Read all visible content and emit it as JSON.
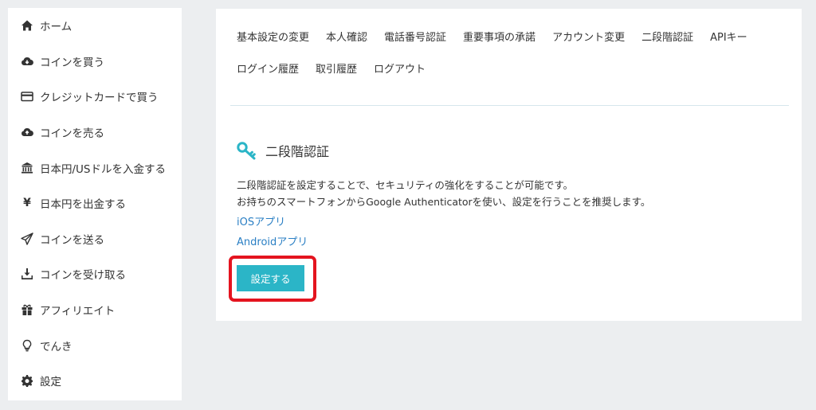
{
  "sidebar": {
    "items": [
      {
        "label": "ホーム",
        "icon": "home-icon"
      },
      {
        "label": "コインを買う",
        "icon": "cloud-download-icon"
      },
      {
        "label": "クレジットカードで買う",
        "icon": "credit-card-icon"
      },
      {
        "label": "コインを売る",
        "icon": "cloud-upload-icon"
      },
      {
        "label": "日本円/USドルを入金する",
        "icon": "bank-icon"
      },
      {
        "label": "日本円を出金する",
        "icon": "yen-icon",
        "glyph": "¥"
      },
      {
        "label": "コインを送る",
        "icon": "paper-plane-icon"
      },
      {
        "label": "コインを受け取る",
        "icon": "download-tray-icon"
      },
      {
        "label": "アフィリエイト",
        "icon": "gift-icon"
      },
      {
        "label": "でんき",
        "icon": "lightbulb-icon"
      },
      {
        "label": "設定",
        "icon": "gear-icon"
      }
    ]
  },
  "tabs": [
    "基本設定の変更",
    "本人確認",
    "電話番号認証",
    "重要事項の承諾",
    "アカウント変更",
    "二段階認証",
    "APIキー",
    "ログイン履歴",
    "取引履歴",
    "ログアウト"
  ],
  "section": {
    "icon": "key-icon",
    "title": "二段階認証",
    "description_line1": "二段階認証を設定することで、セキュリティの強化をすることが可能です。",
    "description_line2": "お持ちのスマートフォンからGoogle Authenticatorを使い、設定を行うことを推奨します。",
    "ios_link": "iOSアプリ",
    "android_link": "Androidアプリ",
    "button_label": "設定する"
  },
  "colors": {
    "accent": "#2bb5c7",
    "link": "#2a7fc4",
    "highlight": "#e4141f",
    "background": "#eceef0"
  }
}
